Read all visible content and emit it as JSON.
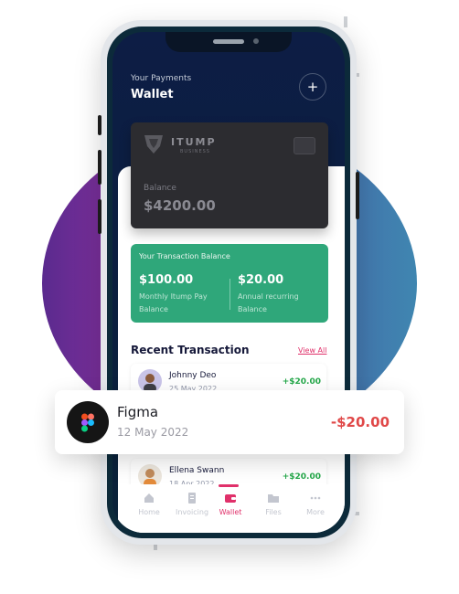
{
  "header": {
    "subtitle": "Your Payments",
    "title": "Wallet",
    "add_icon": "plus-icon"
  },
  "card": {
    "brand": "ITUMP",
    "brand_sub": "BUSINESS",
    "balance_label": "Balance",
    "balance": "$4200.00"
  },
  "transaction_balance": {
    "title": "Your Transaction Balance",
    "items": [
      {
        "amount": "$100.00",
        "desc": "Monthly Itump Pay Balance"
      },
      {
        "amount": "$20.00",
        "desc": "Annual recurring Balance"
      }
    ],
    "color": "#2fa77a"
  },
  "recent": {
    "title": "Recent Transaction",
    "view_all": "View All",
    "rows": [
      {
        "name": "Johnny Deo",
        "date": "25 May 2022",
        "amount": "+$20.00"
      },
      {
        "name": "Ellena Swann",
        "date": "18 Apr 2022",
        "amount": "+$20.00"
      }
    ]
  },
  "floating": {
    "name": "Figma",
    "date": "12 May 2022",
    "amount": "-$20.00",
    "icon": "figma-logo-icon"
  },
  "tabbar": {
    "items": [
      {
        "label": "Home",
        "icon": "home-icon"
      },
      {
        "label": "Invoicing",
        "icon": "invoice-icon"
      },
      {
        "label": "Wallet",
        "icon": "wallet-icon"
      },
      {
        "label": "Files",
        "icon": "folder-icon"
      },
      {
        "label": "More",
        "icon": "more-icon"
      }
    ],
    "active": "Wallet"
  },
  "colors": {
    "accent": "#e0306a",
    "positive": "#25a84a",
    "negative": "#e04848"
  }
}
